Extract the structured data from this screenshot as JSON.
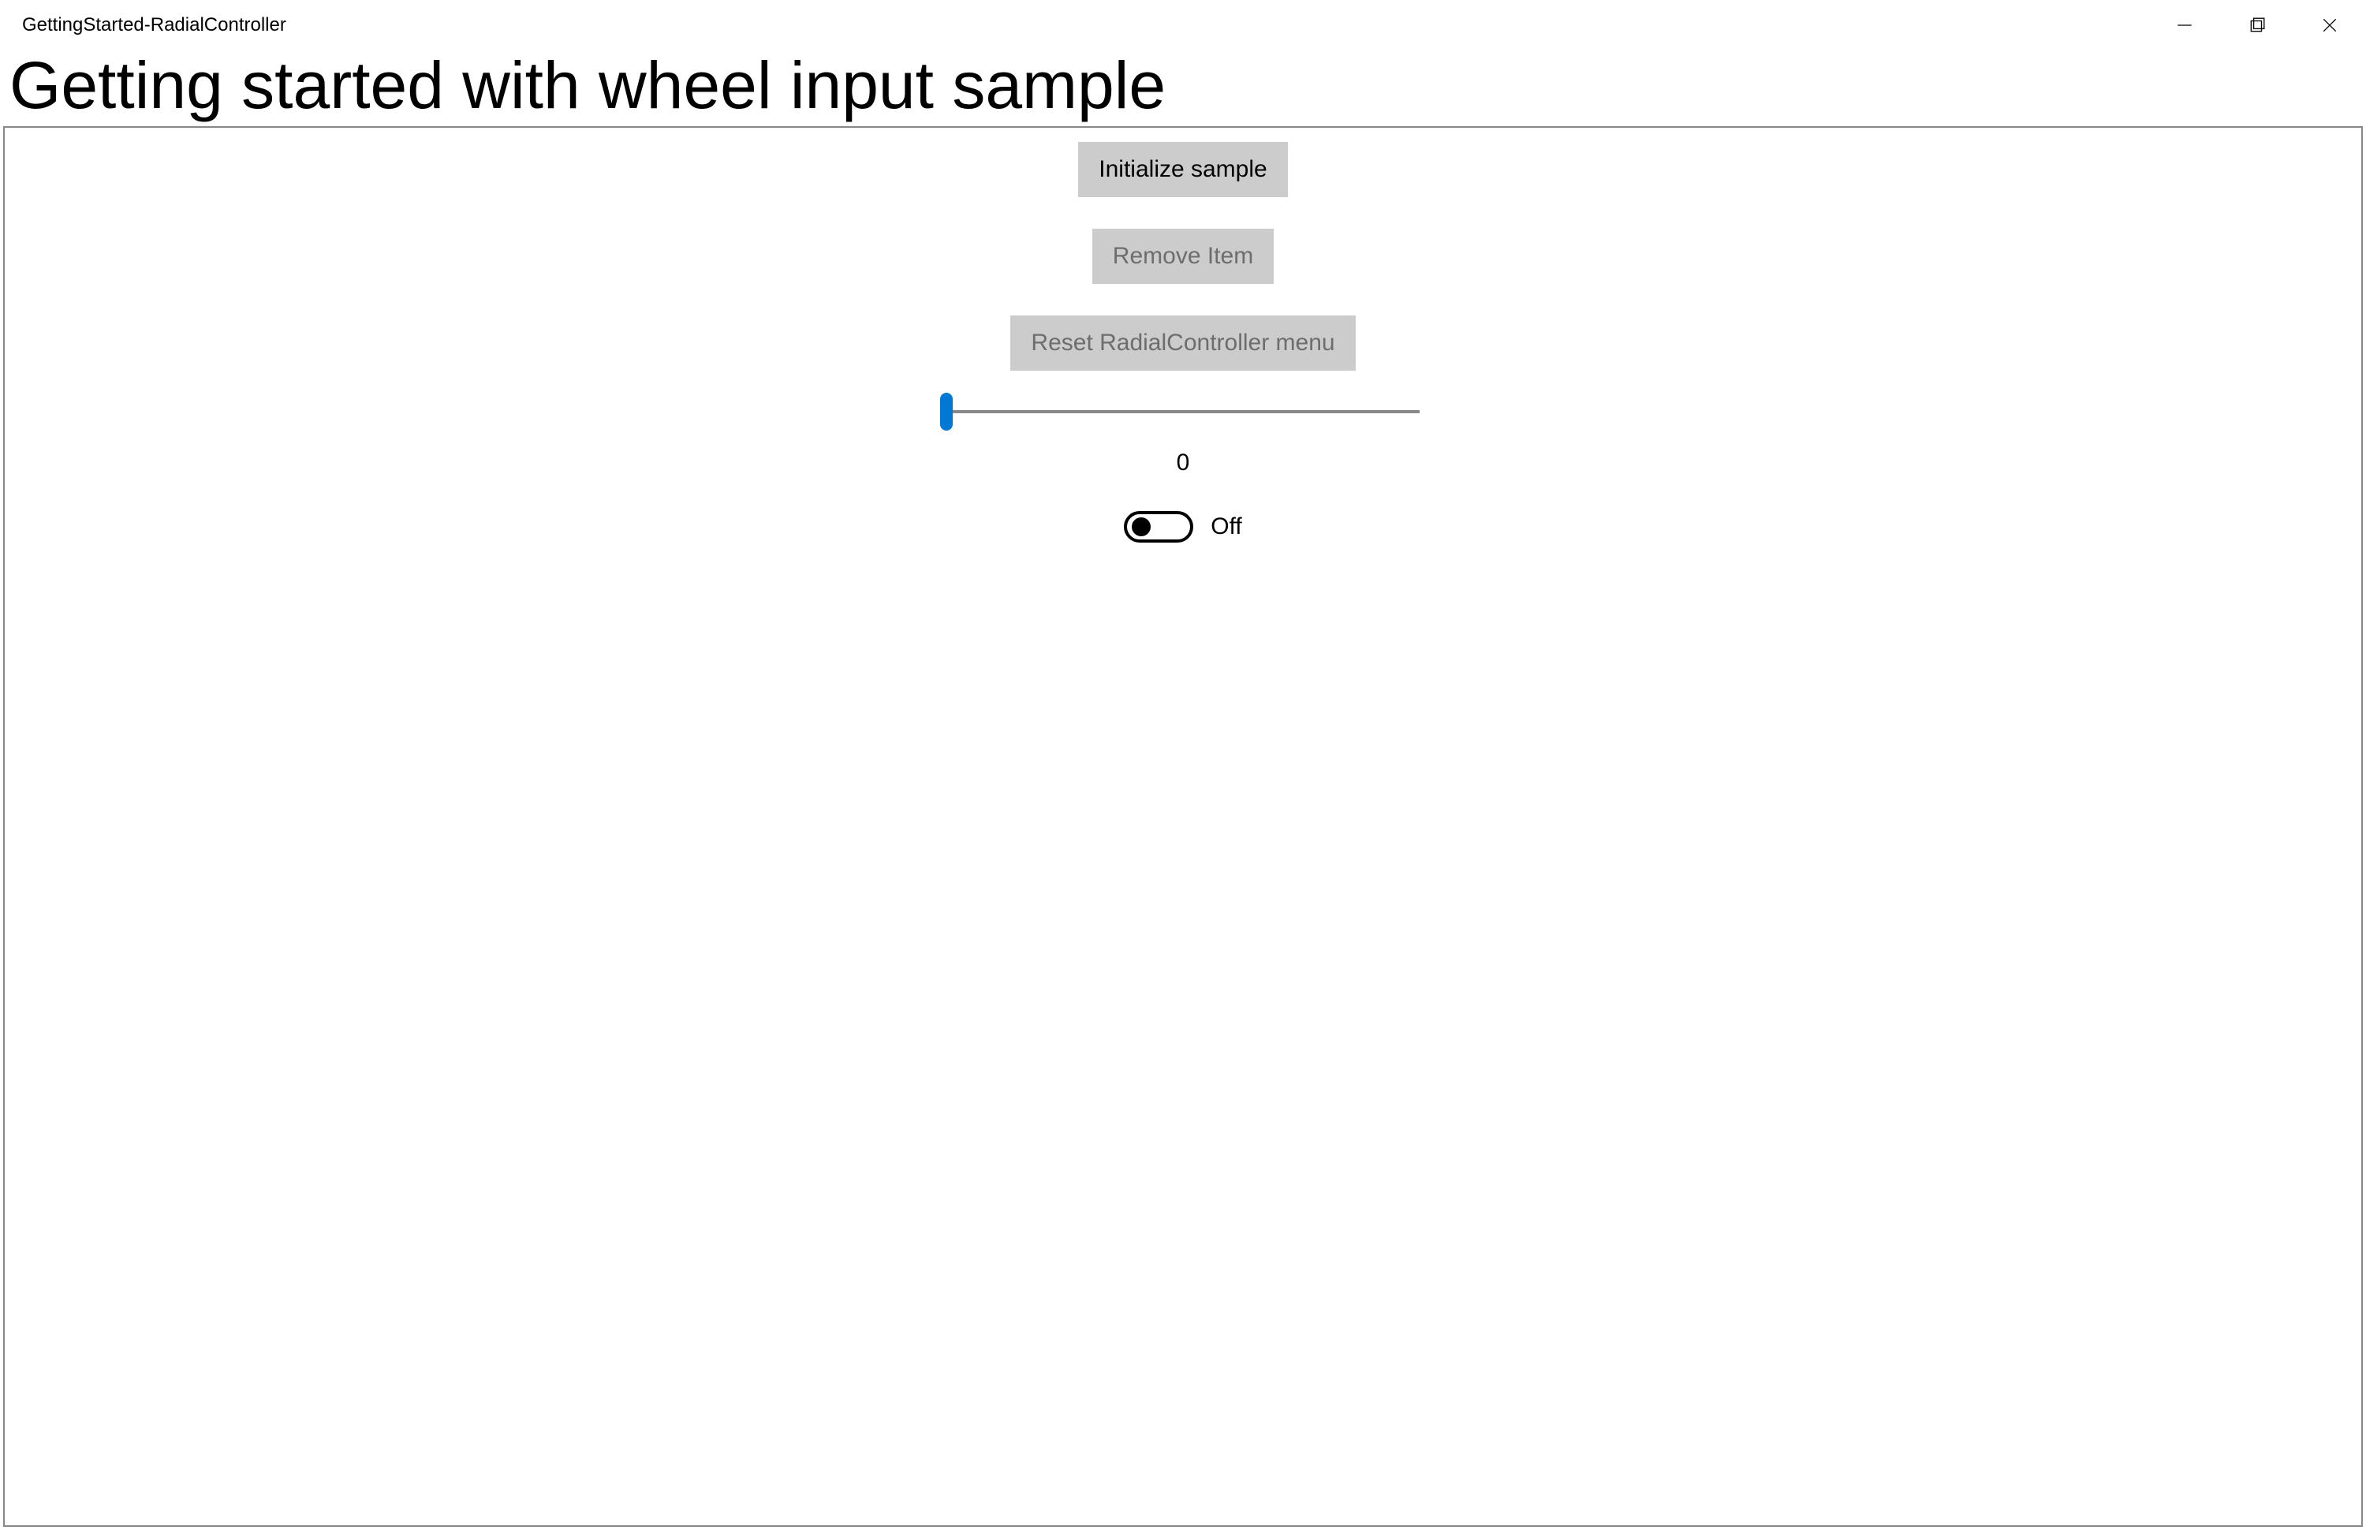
{
  "window": {
    "title": "GettingStarted-RadialController"
  },
  "page": {
    "heading": "Getting started with wheel input sample"
  },
  "controls": {
    "initialize_label": "Initialize sample",
    "remove_label": "Remove Item",
    "reset_label": "Reset RadialController menu",
    "slider_value": "0",
    "toggle_label": "Off"
  }
}
